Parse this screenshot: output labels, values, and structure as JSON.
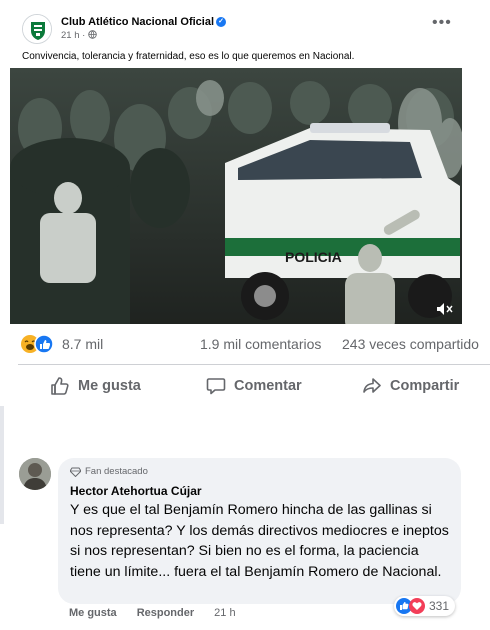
{
  "post": {
    "page_name": "Club Atlético Nacional Oficial",
    "time": "21 h",
    "privacy_icon": "globe-icon",
    "caption": "Convivencia, tolerancia y fraternidad, eso es lo que queremos en Nacional.",
    "video_overlay_text": "POLICIA",
    "volume_icon": "volume-icon"
  },
  "stats": {
    "reactions": "8.7 mil",
    "comments": "1.9 mil comentarios",
    "shares": "243 veces compartido"
  },
  "actions": {
    "like": "Me gusta",
    "comment": "Comentar",
    "share": "Compartir"
  },
  "comment": {
    "badge": "Fan destacado",
    "author": "Hector Atehortua Cújar",
    "text": "Y es que el tal Benjamín Romero hincha de las gallinas si nos representa? Y los demás directivos mediocres e ineptos si nos representan? Si bien no es el forma, la paciencia tiene un límite... fuera el tal Benjamín Romero de Nacional.",
    "like": "Me gusta",
    "reply": "Responder",
    "time": "21 h",
    "reaction_count": "331"
  },
  "colors": {
    "brand_blue": "#1877f2",
    "love_red": "#f33e58",
    "secondary_text": "#65676b",
    "nacional_green": "#0b7a3b"
  }
}
